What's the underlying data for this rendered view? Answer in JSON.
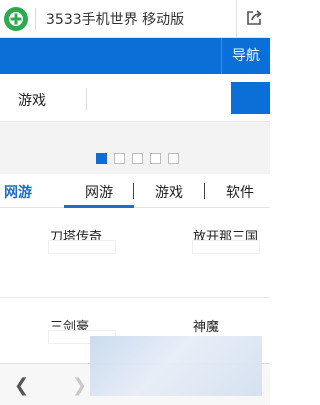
{
  "header": {
    "title": "3533手机世界 移动版",
    "logo_icon": "plus-logo-icon",
    "share_icon": "share-icon"
  },
  "nav": {
    "label": "导航"
  },
  "search": {
    "category": "游戏",
    "placeholder": "",
    "button_icon": "search-icon"
  },
  "carousel": {
    "total": 5,
    "active": 1
  },
  "tabs": {
    "section_label": "网游",
    "items": [
      {
        "label": "网游",
        "active": true
      },
      {
        "label": "游戏",
        "active": false
      },
      {
        "label": "软件",
        "active": false
      }
    ]
  },
  "grid": [
    {
      "name": "刀塔传奇"
    },
    {
      "name": "放开那三国"
    },
    {
      "name": "三剑豪"
    },
    {
      "name": "神魔"
    }
  ],
  "bottom_nav": {
    "back_icon": "chevron-left-icon",
    "forward_icon": "chevron-right-icon"
  },
  "colors": {
    "brand_blue": "#0a6fd6",
    "logo_green": "#2da94f"
  }
}
